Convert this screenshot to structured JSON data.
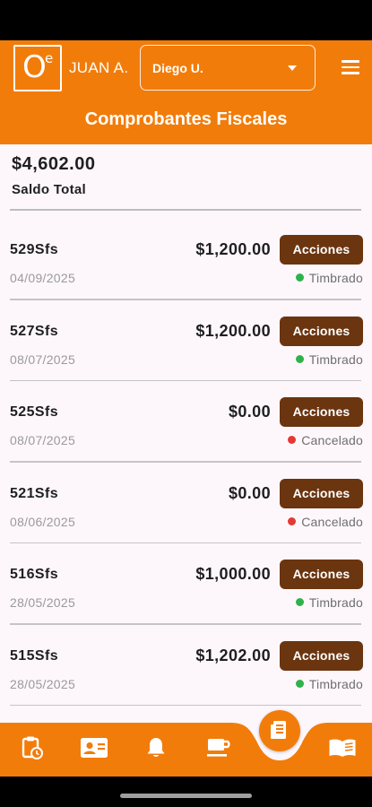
{
  "header": {
    "logo_text": "O",
    "logo_superscript": "e",
    "user_name": "JUAN A.",
    "dropdown_value": "Diego U.",
    "title": "Comprobantes Fiscales",
    "accent_color": "#f27c0a"
  },
  "summary": {
    "amount": "$4,602.00",
    "label": "Saldo Total"
  },
  "rows": [
    {
      "folio": "529Sfs",
      "amount": "$1,200.00",
      "action": "Acciones",
      "date": "04/09/2025",
      "status": "Timbrado",
      "status_color": "#2fb24c"
    },
    {
      "folio": "527Sfs",
      "amount": "$1,200.00",
      "action": "Acciones",
      "date": "08/07/2025",
      "status": "Timbrado",
      "status_color": "#2fb24c"
    },
    {
      "folio": "525Sfs",
      "amount": "$0.00",
      "action": "Acciones",
      "date": "08/07/2025",
      "status": "Cancelado",
      "status_color": "#e53935"
    },
    {
      "folio": "521Sfs",
      "amount": "$0.00",
      "action": "Acciones",
      "date": "08/06/2025",
      "status": "Cancelado",
      "status_color": "#e53935"
    },
    {
      "folio": "516Sfs",
      "amount": "$1,000.00",
      "action": "Acciones",
      "date": "28/05/2025",
      "status": "Timbrado",
      "status_color": "#2fb24c"
    },
    {
      "folio": "515Sfs",
      "amount": "$1,202.00",
      "action": "Acciones",
      "date": "28/05/2025",
      "status": "Timbrado",
      "status_color": "#2fb24c"
    }
  ],
  "bottom_nav": {
    "items": [
      "clipboard-clock-icon",
      "contact-card-icon",
      "bell-icon",
      "coffee-cup-icon",
      "receipt-icon",
      "open-book-icon"
    ],
    "active": "receipt-icon"
  }
}
